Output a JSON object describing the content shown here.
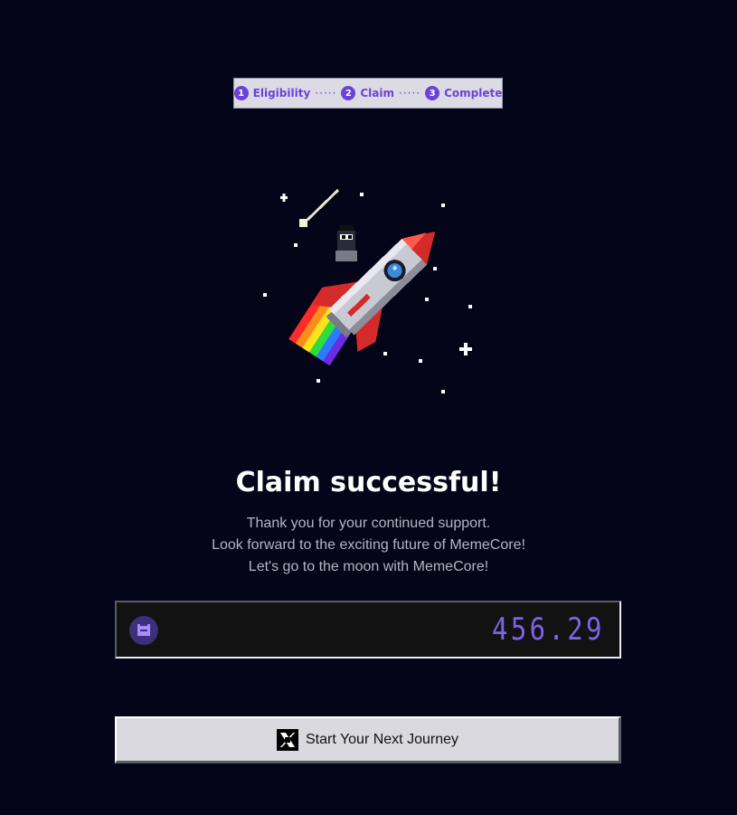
{
  "stepper": {
    "steps": [
      {
        "num": "1",
        "label": "Eligibility"
      },
      {
        "num": "2",
        "label": "Claim"
      },
      {
        "num": "3",
        "label": "Complete"
      }
    ],
    "separator": "·····"
  },
  "main": {
    "title": "Claim successful!",
    "message_lines": [
      "Thank you for your continued support.",
      "Look forward to the exciting future of MemeCore!",
      "Let's go to the moon with MemeCore!"
    ]
  },
  "claim": {
    "amount": "456.29",
    "token_icon": "memecore-token-icon"
  },
  "cta": {
    "label": "Start Your Next Journey",
    "icon": "x-logo-icon"
  },
  "colors": {
    "background": "#05051a",
    "accent": "#6a42d8",
    "amount_digits": "#7d63e6"
  }
}
